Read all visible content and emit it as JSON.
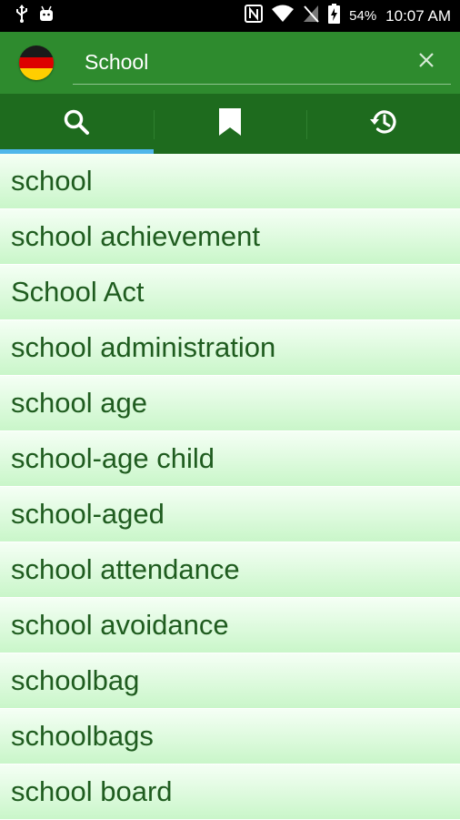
{
  "status_bar": {
    "battery": "54%",
    "time": "10:07 AM",
    "icons": [
      "usb-icon",
      "android-icon",
      "nfc-icon",
      "wifi-icon",
      "no-sim-icon",
      "battery-charging-icon"
    ]
  },
  "search": {
    "value": "School",
    "language_flag": "germany-flag-icon"
  },
  "tabs": [
    {
      "icon": "search-icon",
      "active": true
    },
    {
      "icon": "bookmark-icon",
      "active": false
    },
    {
      "icon": "history-icon",
      "active": false
    }
  ],
  "results": [
    "school",
    "school achievement",
    "School Act",
    "school administration",
    "school age",
    "school-age child",
    "school-aged",
    "school attendance",
    "school avoidance",
    "schoolbag",
    "schoolbags",
    "school board"
  ],
  "colors": {
    "toolbar": "#2e8b2e",
    "tabs": "#1e6b1e",
    "active_tab_indicator": "#4fb6ea",
    "row_text": "#1f5c1f"
  }
}
